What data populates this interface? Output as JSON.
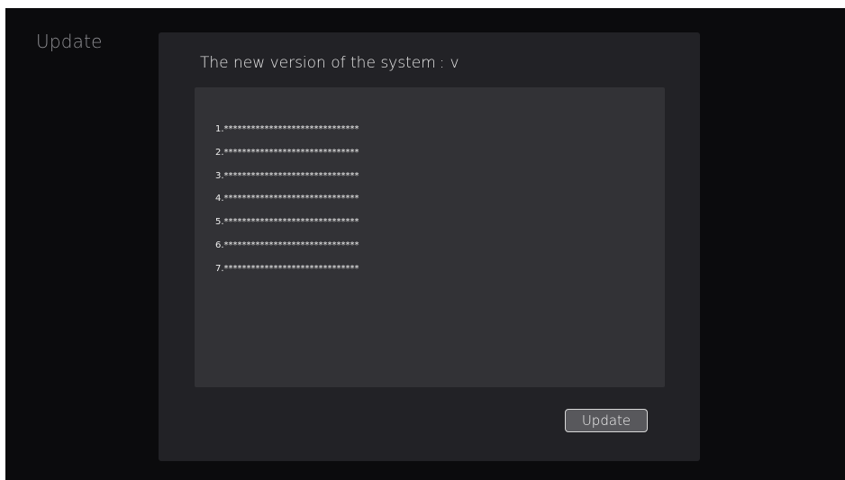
{
  "page": {
    "label": "Update"
  },
  "dialog": {
    "title_prefix": "The new version of the system",
    "title_separator": ":",
    "version": "v",
    "notes": [
      "1.******************************",
      "2.******************************",
      "3.******************************",
      "4.******************************",
      "5.******************************",
      "6.******************************",
      "7.******************************"
    ],
    "update_button_label": "Update"
  }
}
